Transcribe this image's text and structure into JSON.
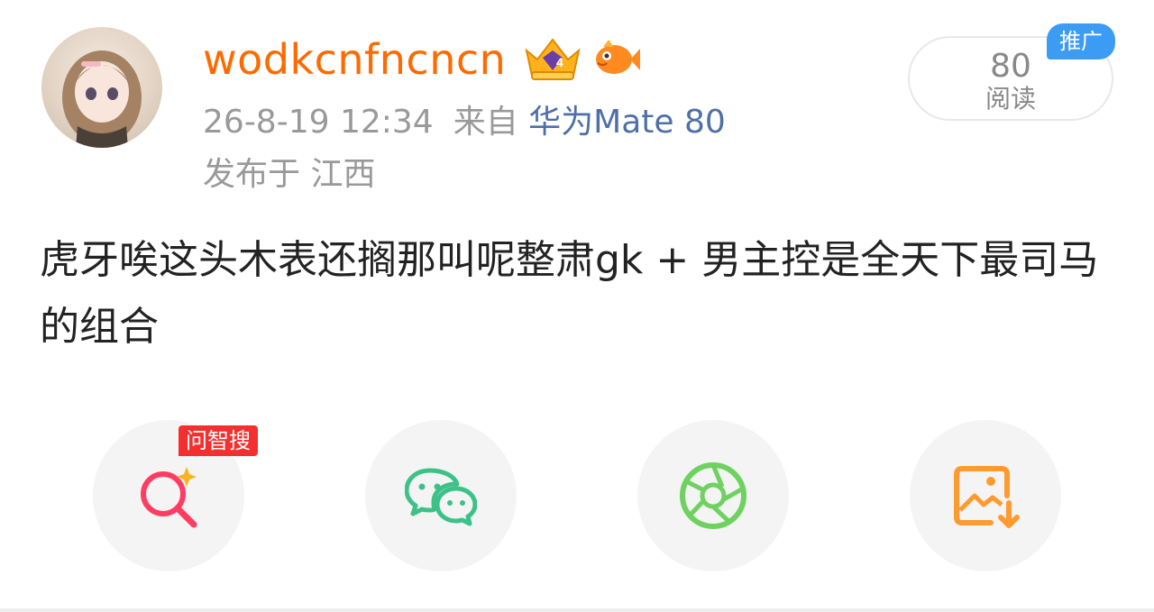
{
  "post": {
    "username": "wodkcnfncncn",
    "timestamp": "26-8-19 12:34",
    "source_prefix": "来自",
    "device": "华为Mate 80",
    "location": "发布于 江西",
    "text": "虎牙唉这头木表还搁那叫呢整肃gk + 男主控是全天下最司马的组合"
  },
  "read": {
    "count": "80",
    "label": "阅读"
  },
  "ad_tag": "推广",
  "share": {
    "search_tag": "问智搜",
    "items": [
      {
        "icon": "smart-search-icon",
        "color": "#ff3d63"
      },
      {
        "icon": "wechat-icon",
        "color": "#3cc288"
      },
      {
        "icon": "moments-aperture-icon",
        "color": "#6ed160"
      },
      {
        "icon": "save-image-icon",
        "color": "#ff9a2e"
      }
    ]
  },
  "colors": {
    "username": "#ff6a00",
    "device": "#4f6fa8",
    "ad_tag": "#3c9cf4"
  }
}
